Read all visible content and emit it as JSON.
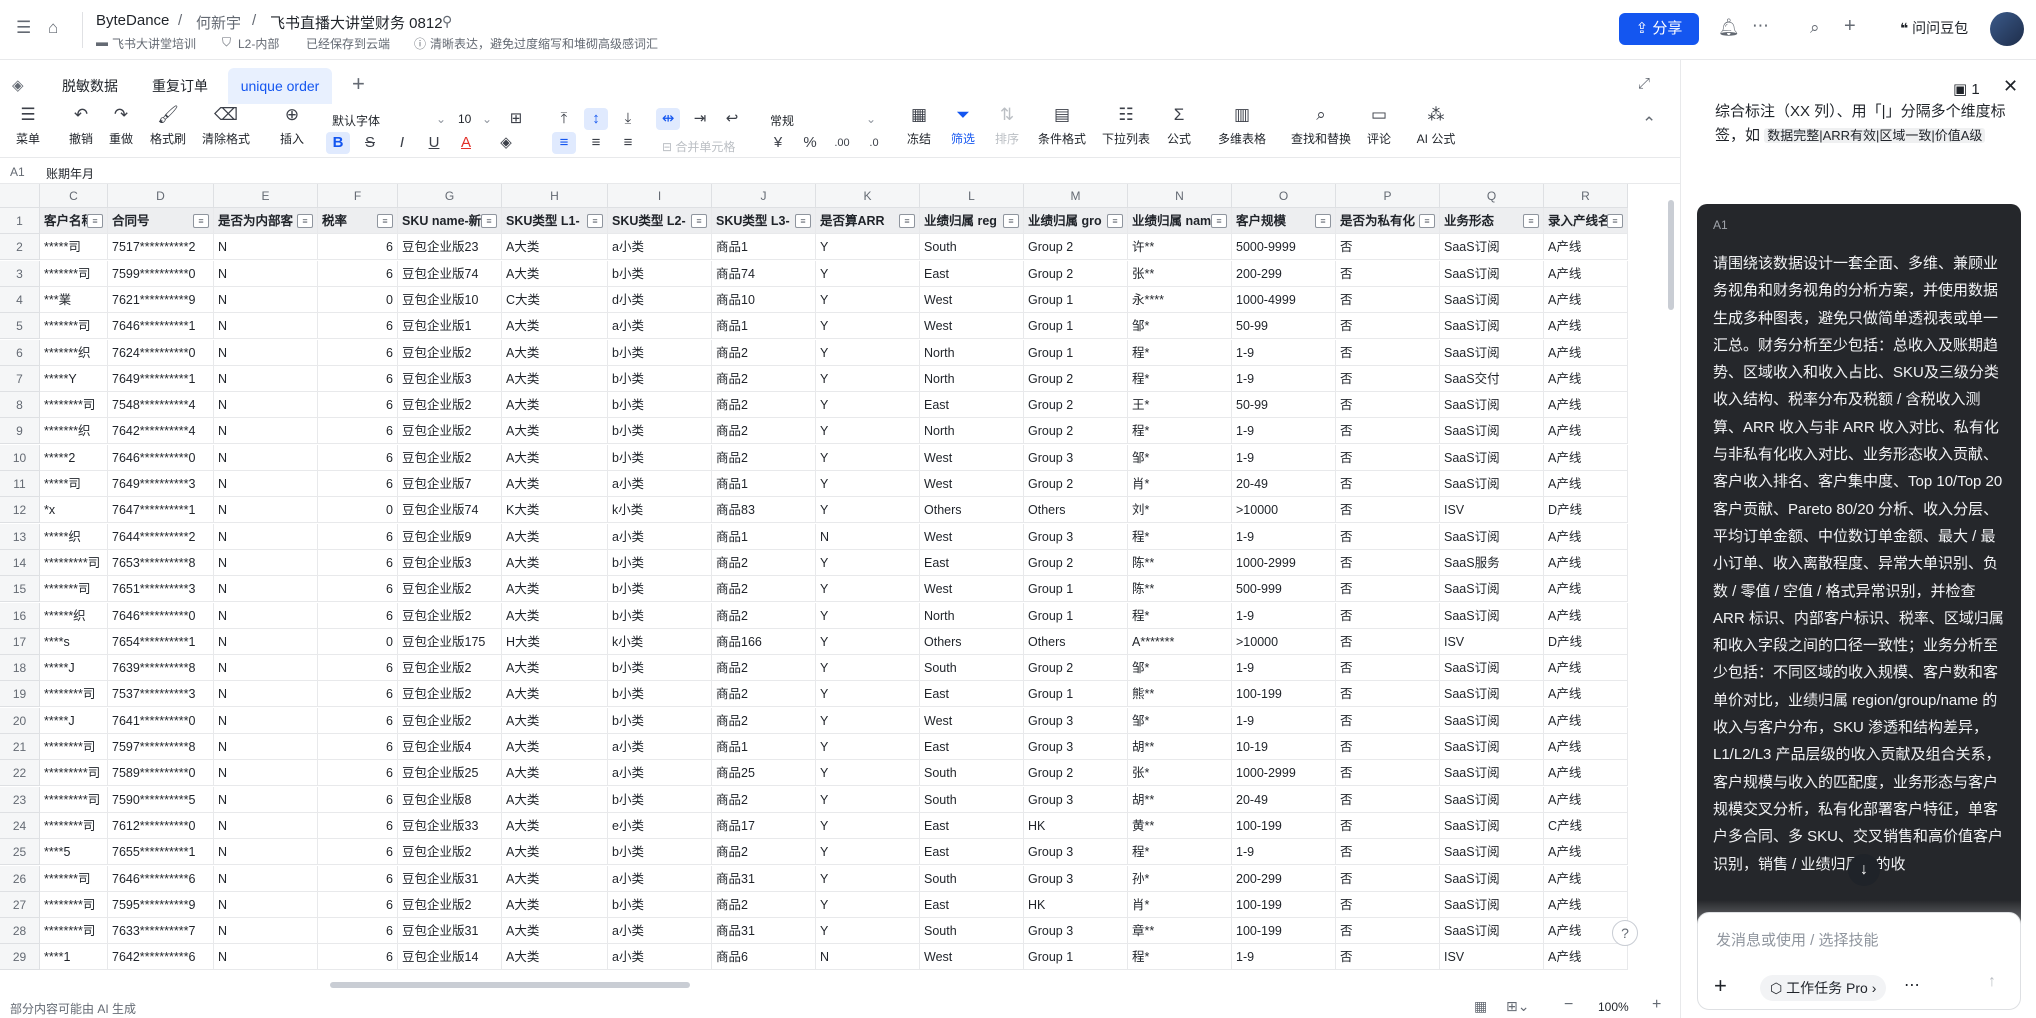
{
  "header": {
    "company": "ByteDance",
    "owner": "何新宇",
    "doc_title": "飞书直播大讲堂财务 0812",
    "folder": "飞书大讲堂培训",
    "security": "L2-内部",
    "save_status": "已经保存到云端",
    "hint": "清晰表达，避免过度缩写和堆砌高级感词汇",
    "share_label": "分享",
    "ask_label": "问问豆包"
  },
  "sheet_tabs": [
    "脱敏数据",
    "重复订单",
    "unique order"
  ],
  "active_tab": 2,
  "toolbar": {
    "menu": "菜单",
    "undo": "撤销",
    "redo": "重做",
    "format_painter": "格式刷",
    "clear_format": "清除格式",
    "insert": "插入",
    "font_family": "默认字体",
    "font_size": "10",
    "merge": "合并单元格",
    "number_format": "常规",
    "freeze": "冻结",
    "filter": "筛选",
    "sort": "排序",
    "conditional": "条件格式",
    "dropdown": "下拉列表",
    "formula": "公式",
    "multi_table": "多维表格",
    "find_replace": "查找和替换",
    "comment": "评论",
    "ai_formula": "AI 公式",
    "percent": "%",
    "currency": "¥",
    "dec": ".00",
    "inc": ".0"
  },
  "formula_bar": {
    "cell_ref": "A1",
    "content": "账期年月"
  },
  "columns": [
    "C",
    "D",
    "E",
    "F",
    "G",
    "H",
    "I",
    "J",
    "K",
    "L",
    "M",
    "N",
    "O",
    "P",
    "Q",
    "R"
  ],
  "headers": [
    "客户名称",
    "合同号",
    "是否为内部客",
    "税率",
    "SKU name-新",
    "SKU类型 L1-",
    "SKU类型 L2-",
    "SKU类型 L3-",
    "是否算ARR",
    "业绩归属 reg",
    "业绩归属 gro",
    "业绩归属 nam",
    "客户规模",
    "是否为私有化",
    "业务形态",
    "录入产线名称"
  ],
  "rows": [
    [
      "*****司",
      "7517**********2",
      "N",
      "6",
      "豆包企业版23",
      "A大类",
      "a小类",
      "商品1",
      "Y",
      "South",
      "Group 2",
      "许**",
      "5000-9999",
      "否",
      "SaaS订阅",
      "A产线"
    ],
    [
      "*******司",
      "7599**********0",
      "N",
      "6",
      "豆包企业版74",
      "A大类",
      "b小类",
      "商品74",
      "Y",
      "East",
      "Group 2",
      "张**",
      "200-299",
      "否",
      "SaaS订阅",
      "A产线"
    ],
    [
      "***業",
      "7621**********9",
      "N",
      "0",
      "豆包企业版10",
      "C大类",
      "d小类",
      "商品10",
      "Y",
      "West",
      "Group 1",
      "永****",
      "1000-4999",
      "否",
      "SaaS订阅",
      "A产线"
    ],
    [
      "*******司",
      "7646**********1",
      "N",
      "6",
      "豆包企业版1",
      "A大类",
      "a小类",
      "商品1",
      "Y",
      "West",
      "Group 1",
      "邹*",
      "50-99",
      "否",
      "SaaS订阅",
      "A产线"
    ],
    [
      "*******织",
      "7624**********0",
      "N",
      "6",
      "豆包企业版2",
      "A大类",
      "b小类",
      "商品2",
      "Y",
      "North",
      "Group 1",
      "程*",
      "1-9",
      "否",
      "SaaS订阅",
      "A产线"
    ],
    [
      "*****Y",
      "7649**********1",
      "N",
      "6",
      "豆包企业版3",
      "A大类",
      "b小类",
      "商品2",
      "Y",
      "North",
      "Group 2",
      "程*",
      "1-9",
      "否",
      "SaaS交付",
      "A产线"
    ],
    [
      "********司",
      "7548**********4",
      "N",
      "6",
      "豆包企业版2",
      "A大类",
      "b小类",
      "商品2",
      "Y",
      "East",
      "Group 2",
      "王*",
      "50-99",
      "否",
      "SaaS订阅",
      "A产线"
    ],
    [
      "*******织",
      "7642**********4",
      "N",
      "6",
      "豆包企业版2",
      "A大类",
      "b小类",
      "商品2",
      "Y",
      "North",
      "Group 2",
      "程*",
      "1-9",
      "否",
      "SaaS订阅",
      "A产线"
    ],
    [
      "*****2",
      "7646**********0",
      "N",
      "6",
      "豆包企业版2",
      "A大类",
      "b小类",
      "商品2",
      "Y",
      "West",
      "Group 3",
      "邹*",
      "1-9",
      "否",
      "SaaS订阅",
      "A产线"
    ],
    [
      "*****司",
      "7649**********3",
      "N",
      "6",
      "豆包企业版7",
      "A大类",
      "a小类",
      "商品1",
      "Y",
      "West",
      "Group 2",
      "肖*",
      "20-49",
      "否",
      "SaaS订阅",
      "A产线"
    ],
    [
      "*x",
      "7647**********1",
      "N",
      "0",
      "豆包企业版74",
      "K大类",
      "k小类",
      "商品83",
      "Y",
      "Others",
      "Others",
      "刘*",
      ">10000",
      "否",
      "ISV",
      "D产线"
    ],
    [
      "*****织",
      "7644**********2",
      "N",
      "6",
      "豆包企业版9",
      "A大类",
      "a小类",
      "商品1",
      "N",
      "West",
      "Group 3",
      "程*",
      "1-9",
      "否",
      "SaaS订阅",
      "A产线"
    ],
    [
      "*********司",
      "7653**********8",
      "N",
      "6",
      "豆包企业版3",
      "A大类",
      "b小类",
      "商品2",
      "Y",
      "East",
      "Group 2",
      "陈**",
      "1000-2999",
      "否",
      "SaaS服务",
      "A产线"
    ],
    [
      "*******司",
      "7651**********3",
      "N",
      "6",
      "豆包企业版2",
      "A大类",
      "b小类",
      "商品2",
      "Y",
      "West",
      "Group 1",
      "陈**",
      "500-999",
      "否",
      "SaaS订阅",
      "A产线"
    ],
    [
      "******织",
      "7646**********0",
      "N",
      "6",
      "豆包企业版2",
      "A大类",
      "b小类",
      "商品2",
      "Y",
      "North",
      "Group 1",
      "程*",
      "1-9",
      "否",
      "SaaS订阅",
      "A产线"
    ],
    [
      "****s",
      "7654**********1",
      "N",
      "0",
      "豆包企业版175",
      "H大类",
      "k小类",
      "商品166",
      "Y",
      "Others",
      "Others",
      "A*******",
      ">10000",
      "否",
      "ISV",
      "D产线"
    ],
    [
      "*****J",
      "7639**********8",
      "N",
      "6",
      "豆包企业版2",
      "A大类",
      "b小类",
      "商品2",
      "Y",
      "South",
      "Group 2",
      "邹*",
      "1-9",
      "否",
      "SaaS订阅",
      "A产线"
    ],
    [
      "********司",
      "7537**********3",
      "N",
      "6",
      "豆包企业版2",
      "A大类",
      "b小类",
      "商品2",
      "Y",
      "East",
      "Group 1",
      "熊**",
      "100-199",
      "否",
      "SaaS订阅",
      "A产线"
    ],
    [
      "*****J",
      "7641**********0",
      "N",
      "6",
      "豆包企业版2",
      "A大类",
      "b小类",
      "商品2",
      "Y",
      "West",
      "Group 3",
      "邹*",
      "1-9",
      "否",
      "SaaS订阅",
      "A产线"
    ],
    [
      "********司",
      "7597**********8",
      "N",
      "6",
      "豆包企业版4",
      "A大类",
      "a小类",
      "商品1",
      "Y",
      "East",
      "Group 3",
      "胡**",
      "10-19",
      "否",
      "SaaS订阅",
      "A产线"
    ],
    [
      "*********司",
      "7589**********0",
      "N",
      "6",
      "豆包企业版25",
      "A大类",
      "a小类",
      "商品25",
      "Y",
      "South",
      "Group 2",
      "张*",
      "1000-2999",
      "否",
      "SaaS订阅",
      "A产线"
    ],
    [
      "*********司",
      "7590**********5",
      "N",
      "6",
      "豆包企业版8",
      "A大类",
      "b小类",
      "商品2",
      "Y",
      "South",
      "Group 3",
      "胡**",
      "20-49",
      "否",
      "SaaS订阅",
      "A产线"
    ],
    [
      "********司",
      "7612**********0",
      "N",
      "6",
      "豆包企业版33",
      "A大类",
      "e小类",
      "商品17",
      "Y",
      "East",
      "HK",
      "黄**",
      "100-199",
      "否",
      "SaaS订阅",
      "C产线"
    ],
    [
      "****5",
      "7655**********1",
      "N",
      "6",
      "豆包企业版2",
      "A大类",
      "b小类",
      "商品2",
      "Y",
      "East",
      "Group 3",
      "程*",
      "1-9",
      "否",
      "SaaS订阅",
      "A产线"
    ],
    [
      "*******司",
      "7646**********6",
      "N",
      "6",
      "豆包企业版31",
      "A大类",
      "a小类",
      "商品31",
      "Y",
      "South",
      "Group 3",
      "孙*",
      "200-299",
      "否",
      "SaaS订阅",
      "A产线"
    ],
    [
      "********司",
      "7595**********9",
      "N",
      "6",
      "豆包企业版2",
      "A大类",
      "b小类",
      "商品2",
      "Y",
      "East",
      "HK",
      "肖*",
      "100-199",
      "否",
      "SaaS订阅",
      "A产线"
    ],
    [
      "********司",
      "7633**********7",
      "N",
      "6",
      "豆包企业版31",
      "A大类",
      "a小类",
      "商品31",
      "Y",
      "South",
      "Group 3",
      "章**",
      "100-199",
      "否",
      "SaaS订阅",
      "A产线"
    ],
    [
      "****1",
      "7642**********6",
      "N",
      "6",
      "豆包企业版14",
      "A大类",
      "a小类",
      "商品6",
      "N",
      "West",
      "Group 1",
      "程*",
      "1-9",
      "否",
      "ISV",
      "A产线"
    ]
  ],
  "status": {
    "ai_note": "部分内容可能由 AI 生成",
    "zoom": "100%"
  },
  "panel": {
    "top_text": "综合标注（XX 列）、用「|」分隔多个维度标签，如",
    "chips": "数据完整|ARR有效|区域一致|价值A级",
    "page_indicator": "1",
    "card_id": "A1",
    "card_text": "请围绕该数据设计一套全面、多维、兼顾业务视角和财务视角的分析方案，并使用数据生成多种图表，避免只做简单透视表或单一汇总。财务分析至少包括：总收入及账期趋势、区域收入和收入占比、SKU及三级分类收入结构、税率分布及税额 / 含税收入测算、ARR 收入与非 ARR 收入对比、私有化与非私有化收入对比、业务形态收入贡献、客户收入排名、客户集中度、Top 10/Top 20 客户贡献、Pareto 80/20 分析、收入分层、平均订单金额、中位数订单金额、最大 / 最小订单、收入离散程度、异常大单识别、负数 / 零值 / 空值 / 格式异常识别，并检查 ARR 标识、内部客户标识、税率、区域归属和收入字段之间的口径一致性；业务分析至少包括：不同区域的收入规模、客户数和客单价对比，业绩归属 region/group/name 的收入与客户分布，SKU 渗透和结构差异，L1/L2/L3 产品层级的收入贡献及组合关系，客户规模与收入的匹配度，业务形态与客户规模交叉分析，私有化部署客户特征，单客户多合同、多 SKU、交叉销售和高价值客户识别，销售 / 业绩归属人的收",
    "input_placeholder": "发消息或使用 / 选择技能",
    "task_label": "工作任务 Pro"
  }
}
